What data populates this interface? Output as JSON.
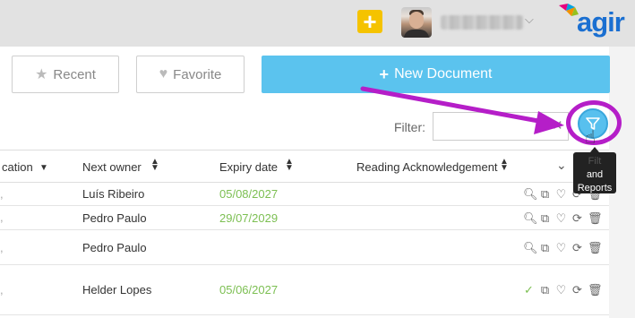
{
  "header": {
    "add_button_label": "+",
    "username": "",
    "logo_text": "agir"
  },
  "toolbar": {
    "recent_label": "Recent",
    "favorite_label": "Favorite",
    "new_document_label": "New Document",
    "filter_label": "Filter:",
    "filter_value": "",
    "tooltip_line1": "Filt",
    "tooltip_line2": "and",
    "tooltip_line3": "Reports"
  },
  "table": {
    "columns": [
      "cation",
      "Next owner",
      "Expiry date",
      "Reading Acknowledgement"
    ],
    "rows": [
      {
        "next_owner": "Luís Ribeiro",
        "expiry": "05/08/2027",
        "acknowledged": false
      },
      {
        "next_owner": "Pedro Paulo",
        "expiry": "29/07/2029",
        "acknowledged": false
      },
      {
        "next_owner": "Pedro Paulo",
        "expiry": "",
        "acknowledged": false
      },
      {
        "next_owner": "Helder Lopes",
        "expiry": "05/06/2027",
        "acknowledged": true
      }
    ]
  },
  "icons": {
    "search": "search-icon",
    "open": "external-link-icon",
    "favorite": "heart-icon",
    "refresh": "refresh-icon",
    "delete": "trash-icon"
  },
  "colors": {
    "accent": "#5bc3ee",
    "highlight": "#b51ec8",
    "date": "#7cbf52",
    "add_button": "#f5c300"
  }
}
